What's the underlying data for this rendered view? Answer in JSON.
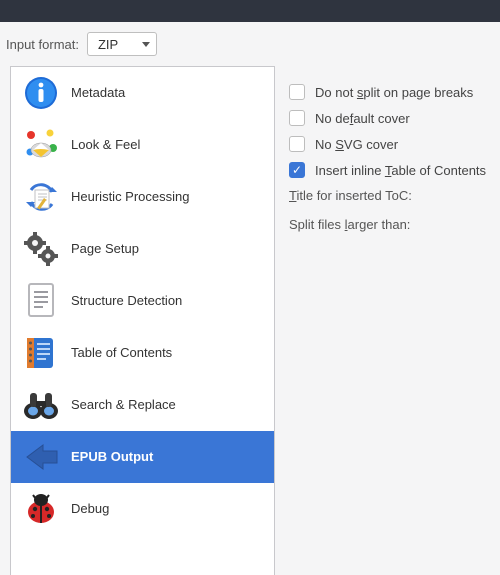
{
  "format_row": {
    "label": "Input format:",
    "value": "ZIP"
  },
  "sidebar": {
    "items": [
      {
        "id": "metadata",
        "label": "Metadata"
      },
      {
        "id": "look-feel",
        "label": "Look & Feel"
      },
      {
        "id": "heuristic",
        "label": "Heuristic Processing"
      },
      {
        "id": "page-setup",
        "label": "Page Setup"
      },
      {
        "id": "structure-detection",
        "label": "Structure Detection"
      },
      {
        "id": "toc",
        "label": "Table of Contents"
      },
      {
        "id": "search-replace",
        "label": "Search & Replace"
      },
      {
        "id": "epub-output",
        "label": "EPUB Output",
        "selected": true
      },
      {
        "id": "debug",
        "label": "Debug"
      }
    ]
  },
  "panel": {
    "checks": [
      {
        "id": "no-split",
        "label_pre": "Do not ",
        "mnemonic": "s",
        "label_post": "plit on page breaks",
        "checked": false
      },
      {
        "id": "no-default-cover",
        "label_pre": "No de",
        "mnemonic": "f",
        "label_post": "ault cover",
        "checked": false
      },
      {
        "id": "no-svg-cover",
        "label_pre": "No ",
        "mnemonic": "S",
        "label_post": "VG cover",
        "checked": false
      },
      {
        "id": "insert-toc",
        "label_pre": "Insert inline ",
        "mnemonic": "T",
        "label_post": "able of Contents",
        "checked": true
      }
    ],
    "title_label_pre": "",
    "title_label_mn": "T",
    "title_label_post": "itle for inserted ToC:",
    "split_label_pre": "Split files ",
    "split_label_mn": "l",
    "split_label_post": "arger than:"
  }
}
